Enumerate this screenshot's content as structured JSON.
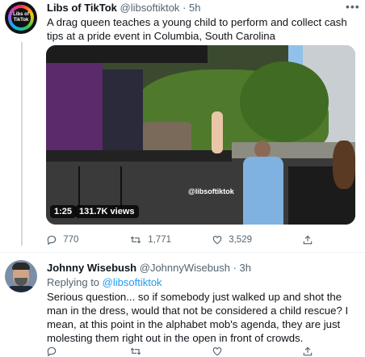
{
  "tweet": {
    "display_name": "Libs of TikTok",
    "handle": "@libsoftiktok",
    "separator": "·",
    "time": "5h",
    "avatar_text": "Libs of TikTok",
    "text": "A drag queen teaches a young child to perform and collect cash tips at a pride event in Columbia, South Carolina",
    "video": {
      "watermark": "@libsoftiktok",
      "duration": "1:25",
      "views": "131.7K views"
    },
    "actions": {
      "replies": "770",
      "retweets": "1,771",
      "likes": "3,529"
    }
  },
  "reply": {
    "display_name": "Johnny Wisebush",
    "handle": "@JohnnyWisebush",
    "separator": "·",
    "time": "3h",
    "replying_prefix": "Replying to",
    "replying_handle": "@libsoftiktok",
    "text": "Serious question... so if somebody just walked up and shot the man in the dress, would that not be considered a child rescue? I mean, at this point in the alphabet mob's agenda, they are just molesting them right out in the open in front of crowds."
  },
  "icons": {
    "reply": "reply-icon",
    "retweet": "retweet-icon",
    "like": "like-icon",
    "share": "share-icon",
    "more": "more-icon"
  },
  "colors": {
    "link": "#1d9bf0",
    "secondary_text": "#536471",
    "primary_text": "#0f1419"
  }
}
